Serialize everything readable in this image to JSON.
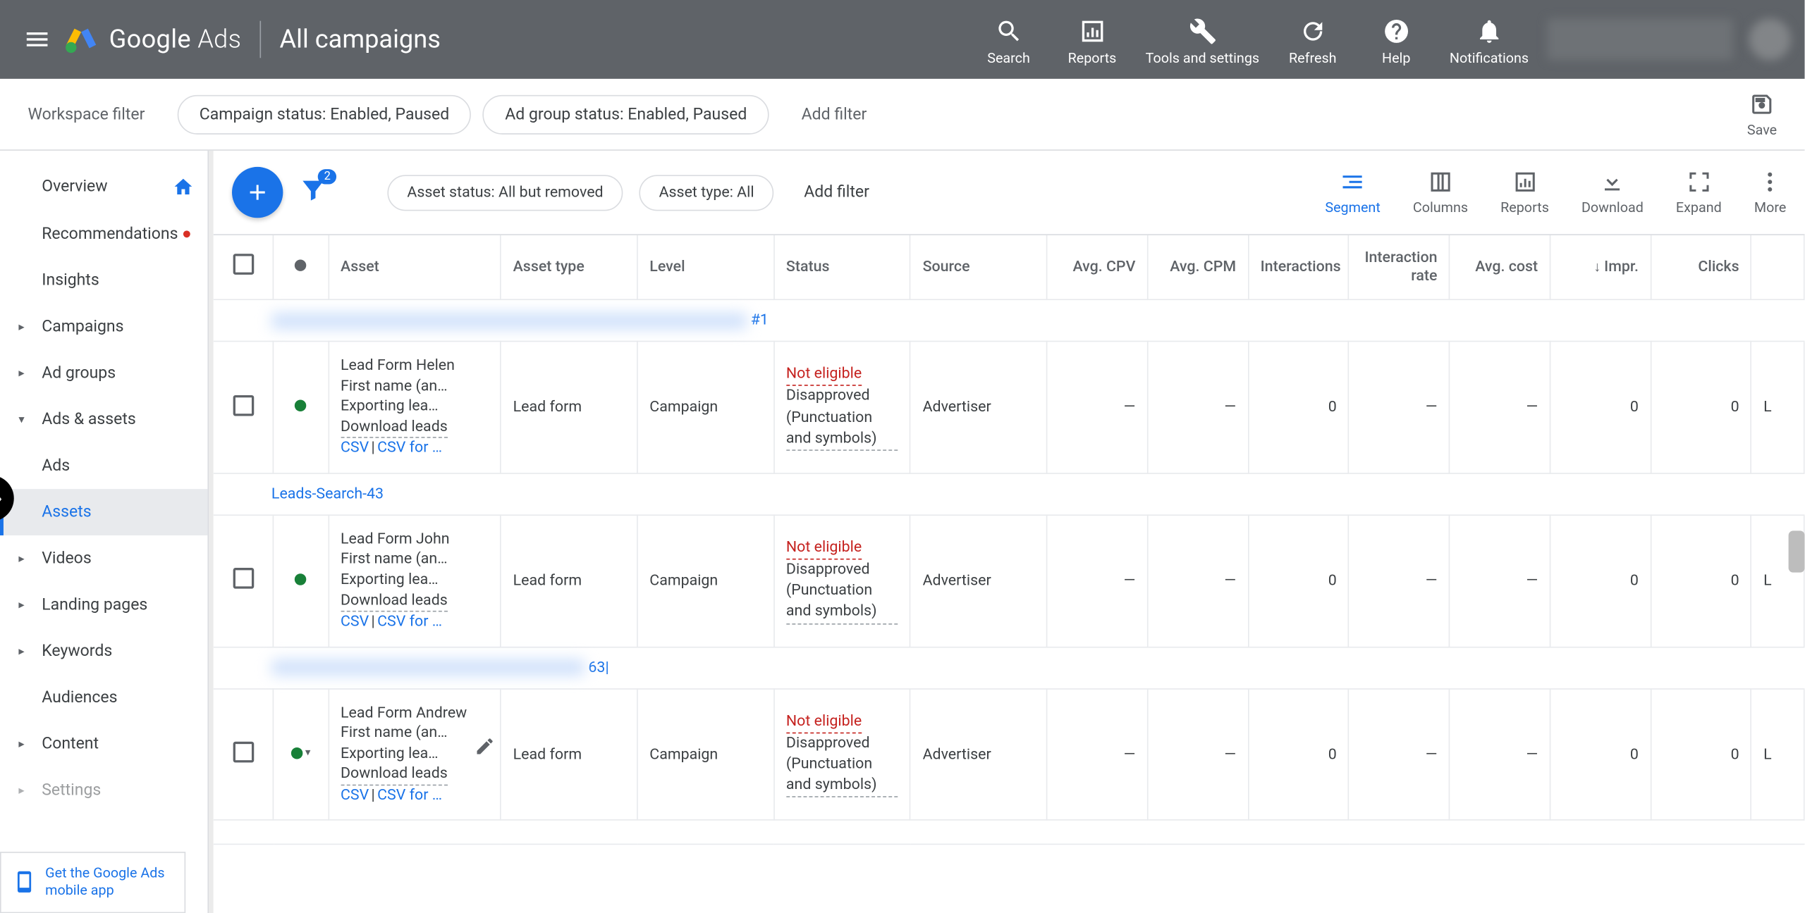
{
  "header": {
    "brand": "Google",
    "brand2": "Ads",
    "title": "All campaigns",
    "actions": {
      "search": "Search",
      "reports": "Reports",
      "tools": "Tools and settings",
      "refresh": "Refresh",
      "help": "Help",
      "notifications": "Notifications"
    }
  },
  "workspace": {
    "label": "Workspace filter",
    "chip1": "Campaign status: Enabled, Paused",
    "chip2": "Ad group status: Enabled, Paused",
    "add": "Add filter",
    "save": "Save"
  },
  "sidebar": {
    "overview": "Overview",
    "recommendations": "Recommendations",
    "insights": "Insights",
    "campaigns": "Campaigns",
    "adgroups": "Ad groups",
    "ads_assets": "Ads & assets",
    "ads": "Ads",
    "assets": "Assets",
    "videos": "Videos",
    "landing": "Landing pages",
    "keywords": "Keywords",
    "audiences": "Audiences",
    "content": "Content",
    "settings": "Settings",
    "mobile_promo": "Get the Google Ads mobile app"
  },
  "toolbar": {
    "filter_count": "2",
    "chip1": "Asset status: All but removed",
    "chip2": "Asset type: All",
    "add_filter": "Add filter",
    "segment": "Segment",
    "columns": "Columns",
    "reports": "Reports",
    "download": "Download",
    "expand": "Expand",
    "more": "More"
  },
  "columns": {
    "asset": "Asset",
    "asset_type": "Asset type",
    "level": "Level",
    "status": "Status",
    "source": "Source",
    "avg_cpv": "Avg. CPV",
    "avg_cpm": "Avg. CPM",
    "interactions": "Interactions",
    "interaction_rate": "Interaction rate",
    "avg_cost": "Avg. cost",
    "impr": "Impr.",
    "clicks": "Clicks"
  },
  "groups": {
    "g1_suffix": "#1",
    "g2": "Leads-Search-43",
    "g3_suffix": "63|"
  },
  "rows": {
    "r1": {
      "asset_line1": "Lead Form Helen",
      "asset_line2": "First name (an…",
      "asset_line3": "Exporting lea…",
      "download_leads": "Download leads",
      "csv": "CSV",
      "csv_for": "CSV for …",
      "asset_type": "Lead form",
      "level": "Campaign",
      "status_ne": "Not eligible",
      "status_da": "Disapproved (Punctuation and symbols)",
      "source": "Advertiser",
      "avg_cpv": "—",
      "avg_cpm": "—",
      "interactions": "0",
      "irate": "—",
      "avg_cost": "—",
      "impr": "0",
      "clicks": "0",
      "extra": "L"
    },
    "r2": {
      "asset_line1": "Lead Form John",
      "asset_line2": "First name (an…",
      "asset_line3": "Exporting lea…",
      "download_leads": "Download leads",
      "csv": "CSV",
      "csv_for": "CSV for …",
      "asset_type": "Lead form",
      "level": "Campaign",
      "status_ne": "Not eligible",
      "status_da": "Disapproved (Punctuation and symbols)",
      "source": "Advertiser",
      "avg_cpv": "—",
      "avg_cpm": "—",
      "interactions": "0",
      "irate": "—",
      "avg_cost": "—",
      "impr": "0",
      "clicks": "0",
      "extra": "L"
    },
    "r3": {
      "asset_line1": "Lead Form Andrew",
      "asset_line2": "First name (an…",
      "asset_line3": "Exporting lea…",
      "download_leads": "Download leads",
      "csv": "CSV",
      "csv_for": "CSV for …",
      "asset_type": "Lead form",
      "level": "Campaign",
      "status_ne": "Not eligible",
      "status_da": "Disapproved (Punctuation and symbols)",
      "source": "Advertiser",
      "avg_cpv": "—",
      "avg_cpm": "—",
      "interactions": "0",
      "irate": "—",
      "avg_cost": "—",
      "impr": "0",
      "clicks": "0",
      "extra": "L"
    }
  }
}
